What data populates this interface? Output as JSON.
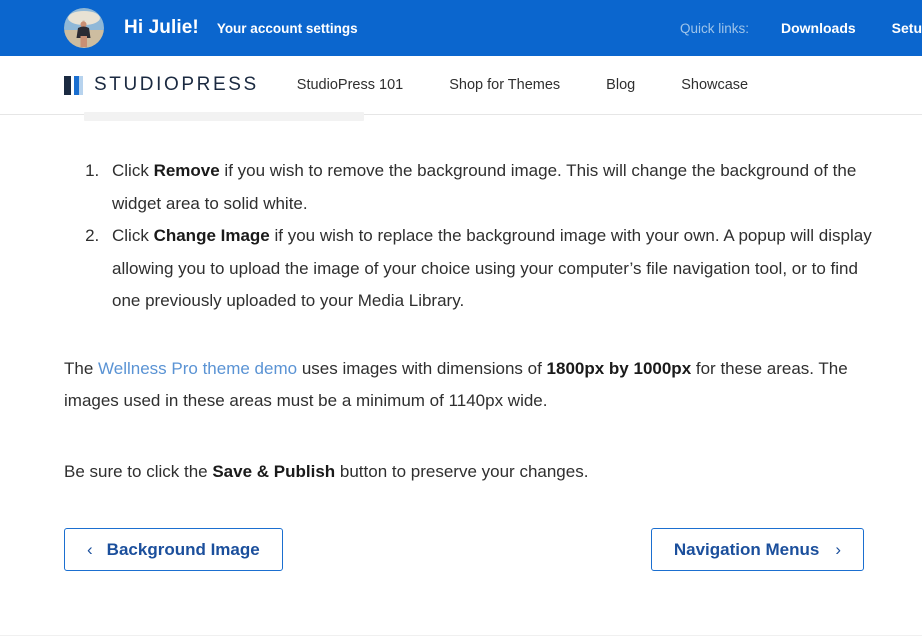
{
  "utility_bar": {
    "background_color": "#0B66CE",
    "avatar_name": "user-avatar",
    "greeting": "Hi Julie!",
    "account_settings_label": "Your account settings",
    "quick_links_label": "Quick links:",
    "quick_links": [
      {
        "label": "Downloads"
      },
      {
        "label": "Setu"
      }
    ]
  },
  "main_nav": {
    "brand": "STUDIOPRESS",
    "brand_mark_colors": [
      "#1b2a41",
      "#1b6fd0",
      "#b7d3ee"
    ],
    "items": [
      {
        "label": "StudioPress 101"
      },
      {
        "label": "Shop for Themes"
      },
      {
        "label": "Blog"
      },
      {
        "label": "Showcase"
      }
    ]
  },
  "content": {
    "steps": [
      {
        "lead": "Click ",
        "bold": "Remove",
        "rest": " if you wish to remove the background image. This will change the background of the widget area to solid white."
      },
      {
        "lead": "Click ",
        "bold": "Change Image",
        "rest": " if you wish to replace the background image with your own. A popup will display allowing you to upload the image of your choice using your computer’s file navigation tool, or to find one previously uploaded to your Media Library."
      }
    ],
    "paragraph_1": {
      "pre": "The ",
      "link": "Wellness Pro theme demo",
      "mid": " uses images with dimensions of ",
      "bold": "1800px by 1000px",
      "post": " for these areas. The images used in these areas must be a minimum of 1140px wide.",
      "link_color": "#5a93d4"
    },
    "paragraph_2": {
      "pre": "Be sure to click the ",
      "bold": "Save & Publish",
      "post": " button to preserve your changes."
    }
  },
  "pager": {
    "prev": {
      "label": "Background Image",
      "icon": "‹"
    },
    "next": {
      "label": "Navigation Menus",
      "icon": "›"
    },
    "border_color": "#1b6fd0",
    "text_color": "#1b4f9c"
  }
}
